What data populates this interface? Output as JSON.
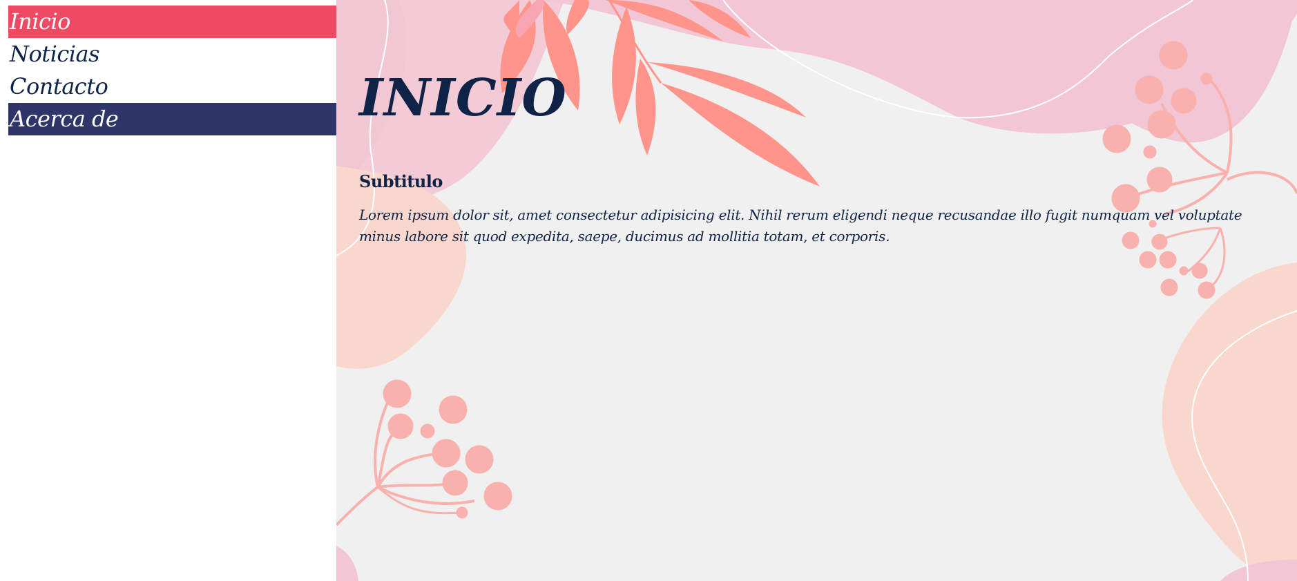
{
  "nav": {
    "items": [
      {
        "label": "Inicio",
        "state": "active",
        "background": "#ef4a63"
      },
      {
        "label": "Noticias",
        "state": "default"
      },
      {
        "label": "Contacto",
        "state": "default"
      },
      {
        "label": "Acerca de",
        "state": "highlighted",
        "background": "#2d3569"
      }
    ]
  },
  "main": {
    "title": "INICIO",
    "subtitle": "Subtitulo",
    "paragraph": "Lorem ipsum dolor sit, amet consectetur adipisicing elit. Nihil rerum eligendi neque recusandae illo fugit numquam vel voluptate minus labore sit quod expedita, saepe, ducimus ad mollitia totam, et corporis."
  },
  "theme": {
    "text_color": "#0f2347",
    "background": "#f1f0f0",
    "blob_pink": "#f2c6d4",
    "blob_peach": "#f9d7cc",
    "leaf_coral": "#ff948a",
    "berry_pink": "#f8b1ad"
  },
  "decorations": [
    "pink-blob",
    "peach-blob",
    "coral-leaf-branch",
    "berry-sprig",
    "white-line-curve"
  ]
}
